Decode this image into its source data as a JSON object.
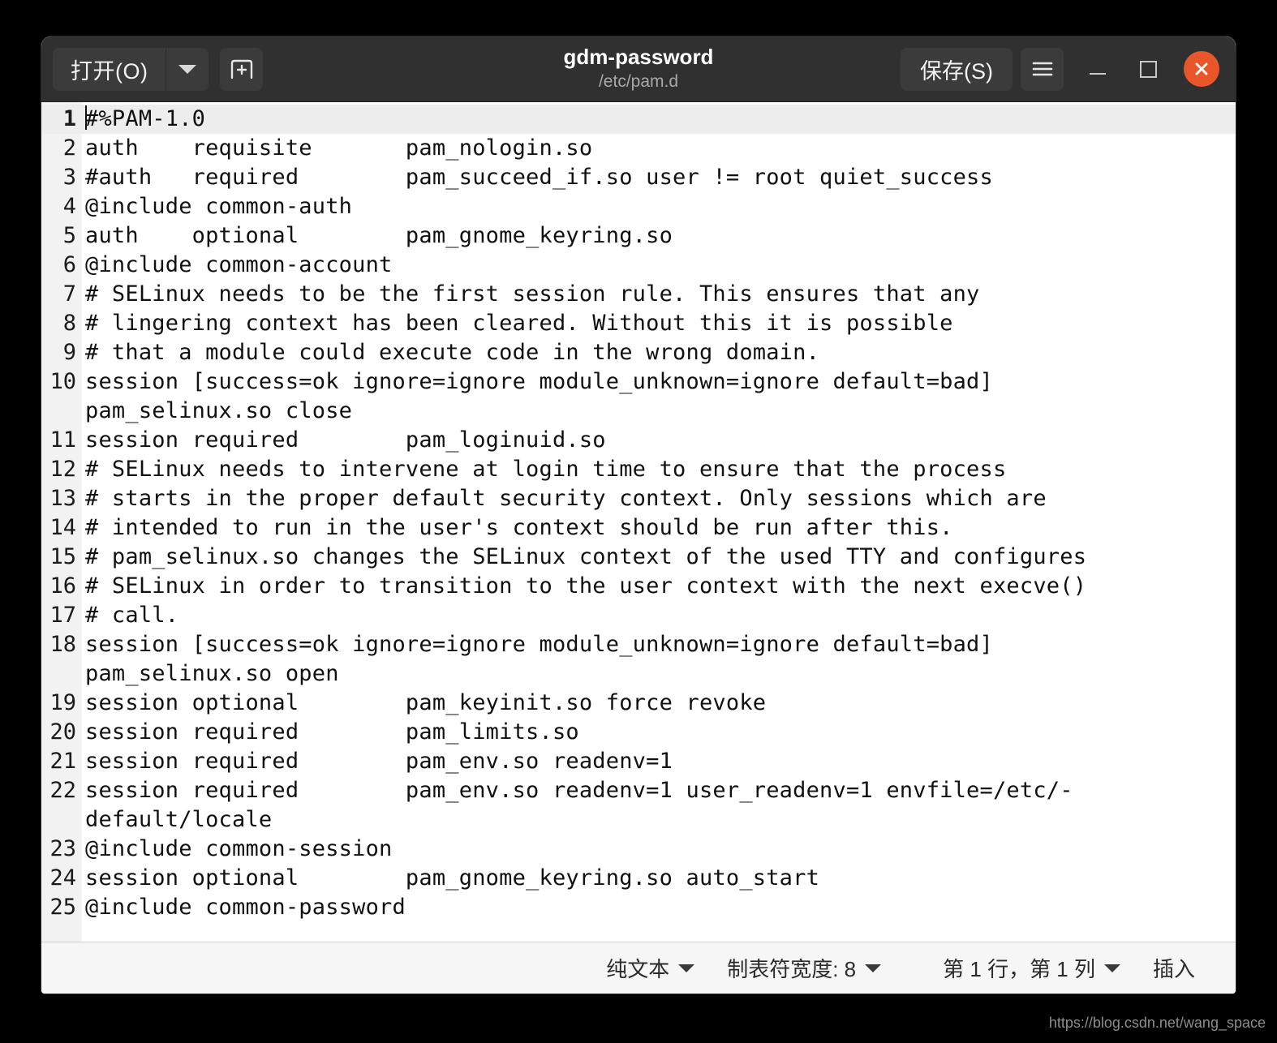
{
  "window": {
    "title": "gdm-password",
    "subtitle": "/etc/pam.d"
  },
  "headerbar": {
    "open_label": "打开(O)",
    "open_dropdown_icon": "chevron-down-icon",
    "new_document_icon": "new-document-icon",
    "save_label": "保存(S)",
    "menu_icon": "hamburger-menu-icon",
    "minimize_icon": "minimize-icon",
    "maximize_icon": "maximize-icon",
    "close_icon": "close-icon",
    "accent_close_color": "#e8562a",
    "background_color": "#303030"
  },
  "editor": {
    "current_line": 1,
    "current_line_highlight_color": "#ededed",
    "gutter_color": "#f2f2f2",
    "lines": [
      {
        "num": "1",
        "text": "#%PAM-1.0",
        "wrap": null,
        "current": true
      },
      {
        "num": "2",
        "text": "auth    requisite       pam_nologin.so",
        "wrap": null,
        "current": false
      },
      {
        "num": "3",
        "text": "#auth   required        pam_succeed_if.so user != root quiet_success",
        "wrap": null,
        "current": false
      },
      {
        "num": "4",
        "text": "@include common-auth",
        "wrap": null,
        "current": false
      },
      {
        "num": "5",
        "text": "auth    optional        pam_gnome_keyring.so",
        "wrap": null,
        "current": false
      },
      {
        "num": "6",
        "text": "@include common-account",
        "wrap": null,
        "current": false
      },
      {
        "num": "7",
        "text": "# SELinux needs to be the first session rule. This ensures that any",
        "wrap": null,
        "current": false
      },
      {
        "num": "8",
        "text": "# lingering context has been cleared. Without this it is possible",
        "wrap": null,
        "current": false
      },
      {
        "num": "9",
        "text": "# that a module could execute code in the wrong domain.",
        "wrap": null,
        "current": false
      },
      {
        "num": "10",
        "text": "session [success=ok ignore=ignore module_unknown=ignore default=bad]",
        "wrap": "pam_selinux.so close",
        "current": false
      },
      {
        "num": "11",
        "text": "session required        pam_loginuid.so",
        "wrap": null,
        "current": false
      },
      {
        "num": "12",
        "text": "# SELinux needs to intervene at login time to ensure that the process",
        "wrap": null,
        "current": false
      },
      {
        "num": "13",
        "text": "# starts in the proper default security context. Only sessions which are",
        "wrap": null,
        "current": false
      },
      {
        "num": "14",
        "text": "# intended to run in the user's context should be run after this.",
        "wrap": null,
        "current": false
      },
      {
        "num": "15",
        "text": "# pam_selinux.so changes the SELinux context of the used TTY and configures",
        "wrap": null,
        "current": false
      },
      {
        "num": "16",
        "text": "# SELinux in order to transition to the user context with the next execve()",
        "wrap": null,
        "current": false
      },
      {
        "num": "17",
        "text": "# call.",
        "wrap": null,
        "current": false
      },
      {
        "num": "18",
        "text": "session [success=ok ignore=ignore module_unknown=ignore default=bad]",
        "wrap": "pam_selinux.so open",
        "current": false
      },
      {
        "num": "19",
        "text": "session optional        pam_keyinit.so force revoke",
        "wrap": null,
        "current": false
      },
      {
        "num": "20",
        "text": "session required        pam_limits.so",
        "wrap": null,
        "current": false
      },
      {
        "num": "21",
        "text": "session required        pam_env.so readenv=1",
        "wrap": null,
        "current": false
      },
      {
        "num": "22",
        "text": "session required        pam_env.so readenv=1 user_readenv=1 envfile=/etc/-",
        "wrap": "default/locale",
        "current": false
      },
      {
        "num": "23",
        "text": "@include common-session",
        "wrap": null,
        "current": false
      },
      {
        "num": "24",
        "text": "session optional        pam_gnome_keyring.so auto_start",
        "wrap": null,
        "current": false
      },
      {
        "num": "25",
        "text": "@include common-password",
        "wrap": null,
        "current": false
      }
    ]
  },
  "statusbar": {
    "syntax_label": "纯文本",
    "tab_width_label": "制表符宽度: 8",
    "position_label": "第 1 行，第 1 列",
    "insert_mode_label": "插入"
  },
  "watermark": {
    "text": "https://blog.csdn.net/wang_space"
  }
}
